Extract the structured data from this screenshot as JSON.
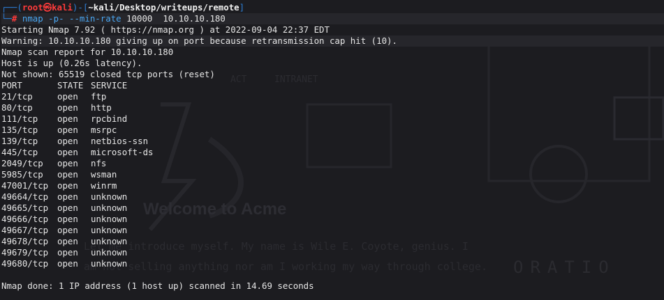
{
  "prompt": {
    "user": "root",
    "at_symbol": "㉿",
    "host": "kali",
    "path": "~kali/Desktop/writeups/remote",
    "symbol": "#"
  },
  "command": {
    "program": "nmap",
    "flags": "-p- --min-rate",
    "rate": "10000",
    "target": "10.10.10.180"
  },
  "output": {
    "start": "Starting Nmap 7.92 ( https://nmap.org ) at 2022-09-04 22:37 EDT",
    "warning": "Warning: 10.10.10.180 giving up on port because retransmission cap hit (10).",
    "report": "Nmap scan report for 10.10.10.180",
    "host_up": "Host is up (0.26s latency).",
    "not_shown": "Not shown: 65519 closed tcp ports (reset)",
    "header": {
      "port": "PORT",
      "state": "STATE",
      "service": "SERVICE"
    },
    "ports": [
      {
        "port": "21/tcp",
        "state": "open",
        "service": "ftp"
      },
      {
        "port": "80/tcp",
        "state": "open",
        "service": "http"
      },
      {
        "port": "111/tcp",
        "state": "open",
        "service": "rpcbind"
      },
      {
        "port": "135/tcp",
        "state": "open",
        "service": "msrpc"
      },
      {
        "port": "139/tcp",
        "state": "open",
        "service": "netbios-ssn"
      },
      {
        "port": "445/tcp",
        "state": "open",
        "service": "microsoft-ds"
      },
      {
        "port": "2049/tcp",
        "state": "open",
        "service": "nfs"
      },
      {
        "port": "5985/tcp",
        "state": "open",
        "service": "wsman"
      },
      {
        "port": "47001/tcp",
        "state": "open",
        "service": "winrm"
      },
      {
        "port": "49664/tcp",
        "state": "open",
        "service": "unknown"
      },
      {
        "port": "49665/tcp",
        "state": "open",
        "service": "unknown"
      },
      {
        "port": "49666/tcp",
        "state": "open",
        "service": "unknown"
      },
      {
        "port": "49667/tcp",
        "state": "open",
        "service": "unknown"
      },
      {
        "port": "49678/tcp",
        "state": "open",
        "service": "unknown"
      },
      {
        "port": "49679/tcp",
        "state": "open",
        "service": "unknown"
      },
      {
        "port": "49680/tcp",
        "state": "open",
        "service": "unknown"
      }
    ],
    "done": "Nmap done: 1 IP address (1 host up) scanned in 14.69 seconds"
  },
  "background": {
    "nav_items": [
      "ACT",
      "INTRANET"
    ],
    "welcome": "Welcome to Acme",
    "intro_1": "Let me introduce myself. My name is Wile E. Coyote, genius. I",
    "intro_2": "am not selling anything nor am I working my way through college.",
    "corp": "ORATIO"
  },
  "colors": {
    "prompt_box": "#2d7fd8",
    "prompt_user": "#ff3b3b",
    "command": "#4aa7f2",
    "text": "#e6e6e6",
    "background": "#1c1c20"
  }
}
